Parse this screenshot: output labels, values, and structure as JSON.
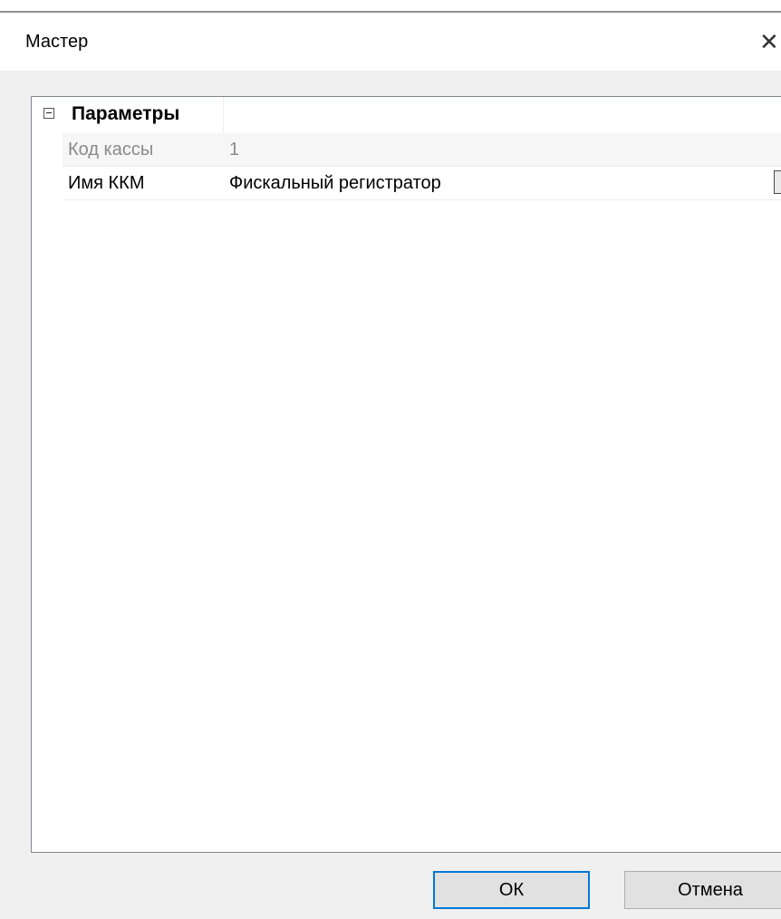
{
  "window": {
    "title": "Мастер",
    "close_glyph": "✕"
  },
  "grid": {
    "category": {
      "label": "Параметры",
      "expander_icon": "collapse-minus-icon"
    },
    "properties": [
      {
        "name": "Код кассы",
        "value": "1",
        "readonly": true
      },
      {
        "name": "Имя ККМ",
        "value": "Фискальный регистратор",
        "has_dropdown": true
      }
    ]
  },
  "buttons": {
    "ok_label": "ОК",
    "cancel_label": "Отмена"
  },
  "colors": {
    "focus_border": "#0078d7",
    "readonly_text": "#8a8a8a"
  }
}
